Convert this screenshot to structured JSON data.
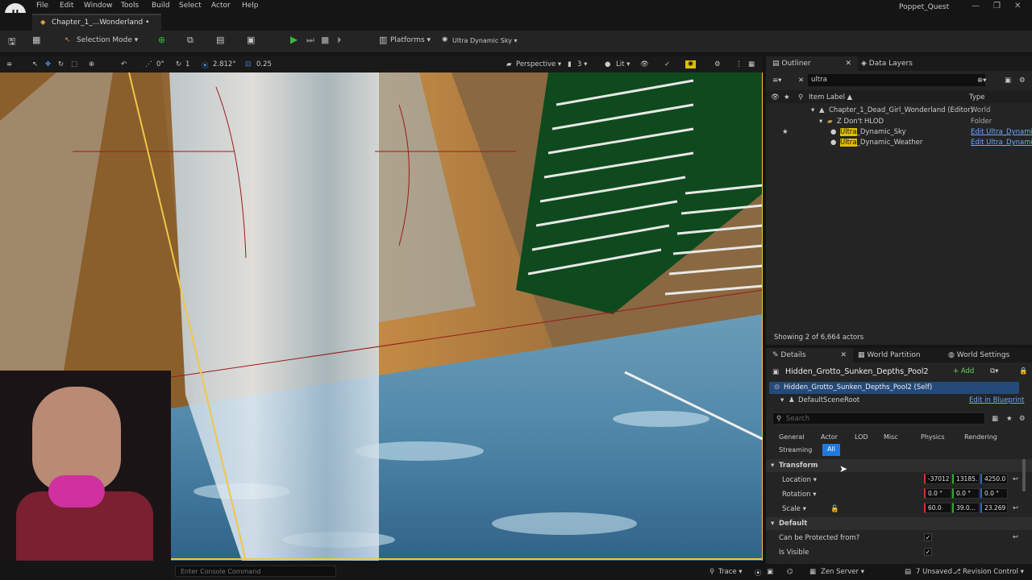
{
  "menu": [
    "File",
    "Edit",
    "Window",
    "Tools",
    "Build",
    "Select",
    "Actor",
    "Help"
  ],
  "document_tab": "Chapter_1_...Wonderland •",
  "project_name": "Poppet_Quest",
  "toolbar": {
    "selection_mode": "Selection Mode ▾",
    "platforms": "Platforms ▾",
    "sky": "Ultra Dynamic Sky ▾"
  },
  "viewport_toolbar": {
    "rotate_snap": "0°",
    "grid_count": "1",
    "scale_snap": "2.812°",
    "speed": "0.25",
    "perspective": "Perspective ▾",
    "view_count": "3 ▾",
    "lit": "Lit ▾"
  },
  "console": {
    "placeholder": "Enter Console Command"
  },
  "statusbar": {
    "trace": "Trace ▾",
    "zen": "Zen Server ▾",
    "unsaved": "7 Unsaved",
    "revision": "Revision Control ▾"
  },
  "outliner": {
    "tab": "Outliner",
    "tab2": "Data Layers",
    "search_value": "ultra",
    "col_label": "Item Label ▲",
    "col_type": "Type",
    "rows": [
      {
        "label": "Chapter_1_Dead_Girl_Wonderland (Editor)",
        "type": "World"
      },
      {
        "label": "Z Don't HLOD",
        "type": "Folder"
      },
      {
        "hl": "Ultra",
        "rest": "_Dynamic_Sky",
        "type": "Edit Ultra_Dynamic"
      },
      {
        "hl": "Ultra",
        "rest": "_Dynamic_Weather",
        "type": "Edit Ultra_Dynamic"
      }
    ],
    "footer": "Showing 2 of 6,664 actors"
  },
  "details": {
    "tab": "Details",
    "tab2": "World Partition",
    "tab3": "World Settings",
    "actor_name": "Hidden_Grotto_Sunken_Depths_Pool2",
    "add_label": "+ Add",
    "self_row": "Hidden_Grotto_Sunken_Depths_Pool2 (Self)",
    "scene_root": "DefaultSceneRoot",
    "edit_bp": "Edit in Blueprint",
    "search_placeholder": "Search",
    "filters": [
      "General",
      "Actor",
      "LOD",
      "Misc",
      "Physics",
      "Rendering",
      "Streaming",
      "All"
    ],
    "transform_header": "Transform",
    "location": {
      "label": "Location ▾",
      "x": "-37012",
      "y": "13185.",
      "z": "4250.0"
    },
    "rotation": {
      "label": "Rotation ▾",
      "x": "0.0 °",
      "y": "0.0 °",
      "z": "0.0 °"
    },
    "scale": {
      "label": "Scale ▾",
      "x": "60.0",
      "y": "39.0...",
      "z": "23.269"
    },
    "default_header": "Default",
    "protected_label": "Can be Protected from?",
    "visible_label": "Is Visible"
  },
  "colors": {
    "accent_play": "#3bb53b",
    "selection_yellow": "#e0c000",
    "link_blue": "#6aa9ff"
  }
}
